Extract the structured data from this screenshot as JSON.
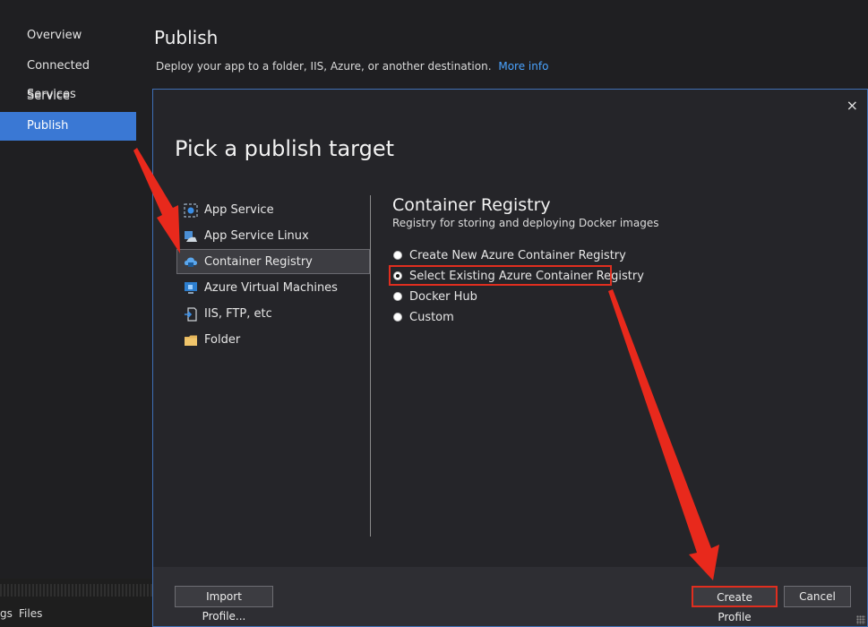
{
  "sidebar": {
    "items": [
      {
        "label": "Overview",
        "active": false
      },
      {
        "label": "Connected Services",
        "active": false
      },
      {
        "label": "Service References",
        "active": false
      },
      {
        "label": "Publish",
        "active": true
      }
    ],
    "bottom_tabs": [
      "gs",
      "Files"
    ]
  },
  "header": {
    "title": "Publish",
    "subtitle": "Deploy your app to a folder, IIS, Azure, or another destination.",
    "more_info_link": "More info"
  },
  "dialog": {
    "close_icon": "×",
    "title": "Pick a publish target",
    "targets": [
      {
        "label": "App Service",
        "icon": "app-service-icon",
        "selected": false
      },
      {
        "label": "App Service Linux",
        "icon": "app-service-linux-icon",
        "selected": false
      },
      {
        "label": "Container Registry",
        "icon": "container-registry-icon",
        "selected": true
      },
      {
        "label": "Azure Virtual Machines",
        "icon": "azure-vm-icon",
        "selected": false
      },
      {
        "label": "IIS, FTP, etc",
        "icon": "iis-ftp-icon",
        "selected": false
      },
      {
        "label": "Folder",
        "icon": "folder-icon",
        "selected": false
      }
    ],
    "details": {
      "title": "Container Registry",
      "subtitle": "Registry for storing and deploying Docker images",
      "options": [
        {
          "label": "Create New Azure Container Registry",
          "checked": false
        },
        {
          "label": "Select Existing Azure Container Registry",
          "checked": true
        },
        {
          "label": "Docker Hub",
          "checked": false
        },
        {
          "label": "Custom",
          "checked": false
        }
      ]
    },
    "buttons": {
      "import_profile": "Import Profile...",
      "create_profile": "Create Profile",
      "cancel": "Cancel"
    }
  },
  "colors": {
    "accent": "#3a78d4",
    "link": "#4aa3ff",
    "annotation_red": "#e02e1f",
    "dialog_border": "#3f6fb5"
  }
}
